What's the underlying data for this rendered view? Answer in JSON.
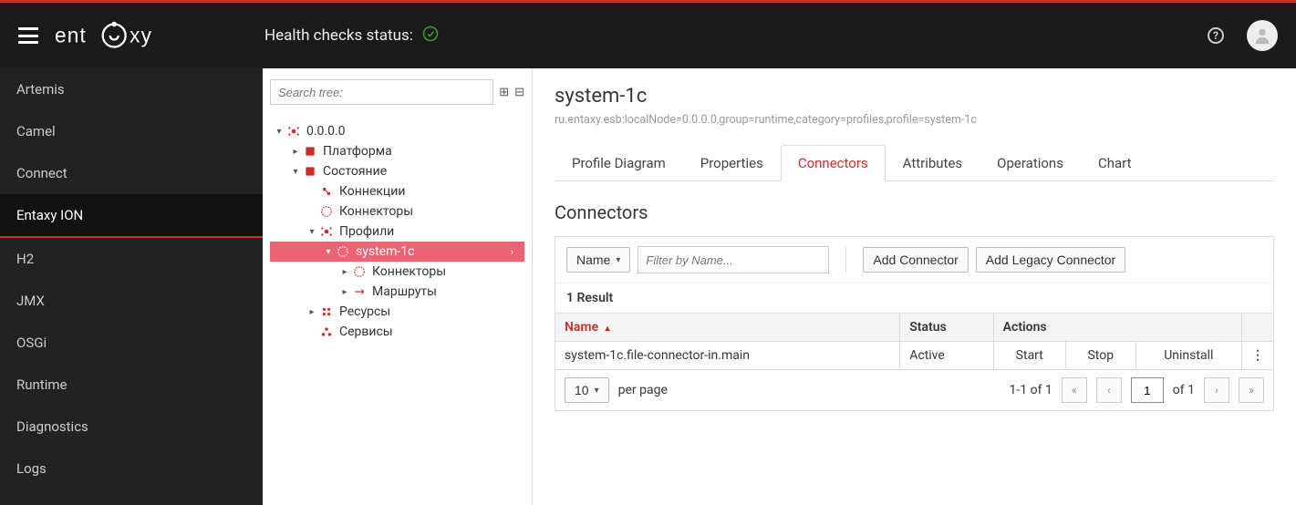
{
  "topbar": {
    "health_label": "Health checks status:",
    "logo_text": "entaxy"
  },
  "sidebar": {
    "items": [
      {
        "label": "Artemis"
      },
      {
        "label": "Camel"
      },
      {
        "label": "Connect"
      },
      {
        "label": "Entaxy ION",
        "active": true
      },
      {
        "label": "H2"
      },
      {
        "label": "JMX"
      },
      {
        "label": "OSGi"
      },
      {
        "label": "Runtime"
      },
      {
        "label": "Diagnostics"
      },
      {
        "label": "Logs"
      }
    ]
  },
  "tree": {
    "search_placeholder": "Search tree:",
    "root": "0.0.0.0",
    "platform": "Платформа",
    "state": "Состояние",
    "connections": "Коннекции",
    "connectors": "Коннекторы",
    "profiles": "Профили",
    "system1c": "system-1c",
    "system1c_connectors": "Коннекторы",
    "system1c_routes": "Маршруты",
    "resources": "Ресурсы",
    "services": "Сервисы"
  },
  "main": {
    "title": "system-1c",
    "subtitle": "ru.entaxy.esb:localNode=0.0.0.0,group=runtime,category=profiles,profile=system-1c",
    "tabs": {
      "profile_diagram": "Profile Diagram",
      "properties": "Properties",
      "connectors": "Connectors",
      "attributes": "Attributes",
      "operations": "Operations",
      "chart": "Chart"
    },
    "section": "Connectors",
    "filter_dd": "Name",
    "filter_placeholder": "Filter by Name...",
    "add_connector": "Add Connector",
    "add_legacy": "Add Legacy Connector",
    "result_count": "1 Result",
    "columns": {
      "name": "Name",
      "status": "Status",
      "actions": "Actions"
    },
    "row": {
      "name": "system-1c.file-connector-in.main",
      "status": "Active",
      "start": "Start",
      "stop": "Stop",
      "uninstall": "Uninstall"
    },
    "pager": {
      "per_page_value": "10",
      "per_page_label": "per page",
      "range": "1-1 of 1",
      "page_value": "1",
      "of_label": "of 1"
    }
  }
}
